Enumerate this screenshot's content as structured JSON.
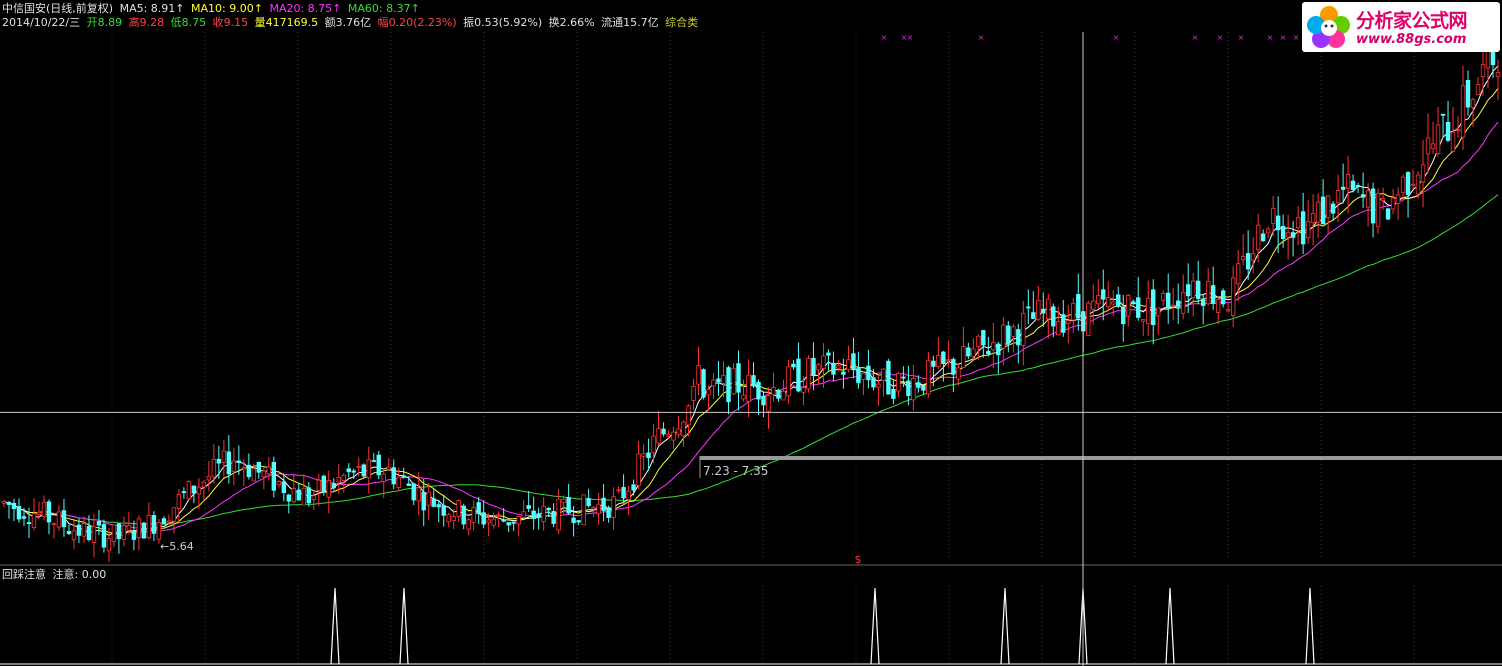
{
  "header": {
    "stock": "中信国安(日线,前复权)",
    "ma5": "MA5: 8.91↑",
    "ma10": "MA10: 9.00↑",
    "ma20": "MA20: 8.75↑",
    "ma60": "MA60: 8.37↑",
    "date": "2014/10/22/三",
    "open": "开8.89",
    "high": "高9.28",
    "low": "低8.75",
    "close": "收9.15",
    "volume": "量417169.5",
    "amount": "额3.76亿",
    "change": "幅0.20(2.23%)",
    "amplitude": "振0.53(5.92%)",
    "turnover": "换2.66%",
    "float": "流通15.7亿",
    "category": "综合类"
  },
  "logo": {
    "title": "分析家公式网",
    "url": "www.88gs.com"
  },
  "indicator": {
    "name": "回踩注意",
    "label": "注意: 0.00"
  },
  "annotations": {
    "low_label": "5.64",
    "range_label": "7.23 - 7.35",
    "signal_marker": "$"
  },
  "colors": {
    "background": "#000000",
    "up": "#ff3333",
    "down": "#55ffff",
    "ma5": "#ffffff",
    "ma10": "#ffff33",
    "ma20": "#ff33ff",
    "ma60": "#33dd33"
  },
  "chart_data": {
    "type": "candlestick",
    "price_range": [
      5.3,
      14.6
    ],
    "crosshair_price": 7.9,
    "candles_sample": [
      {
        "o": 6.2,
        "h": 6.35,
        "l": 6.05,
        "c": 6.1
      },
      {
        "o": 6.1,
        "h": 6.25,
        "l": 5.95,
        "c": 6.0
      },
      {
        "o": 5.95,
        "h": 6.05,
        "l": 5.75,
        "c": 5.8
      },
      {
        "o": 5.8,
        "h": 5.9,
        "l": 5.64,
        "c": 5.85
      },
      {
        "o": 6.0,
        "h": 6.5,
        "l": 5.95,
        "c": 6.45
      },
      {
        "o": 6.6,
        "h": 7.2,
        "l": 6.5,
        "c": 7.1
      },
      {
        "o": 7.0,
        "h": 7.25,
        "l": 6.6,
        "c": 6.7
      },
      {
        "o": 6.5,
        "h": 6.7,
        "l": 6.1,
        "c": 6.2
      },
      {
        "o": 6.6,
        "h": 7.0,
        "l": 6.5,
        "c": 6.9
      },
      {
        "o": 6.9,
        "h": 7.05,
        "l": 6.4,
        "c": 6.5
      },
      {
        "o": 6.1,
        "h": 6.2,
        "l": 5.9,
        "c": 5.95
      },
      {
        "o": 6.0,
        "h": 6.1,
        "l": 5.95,
        "c": 6.05
      },
      {
        "o": 6.3,
        "h": 6.45,
        "l": 6.25,
        "c": 6.4
      },
      {
        "o": 7.23,
        "h": 8.0,
        "l": 7.2,
        "c": 7.9
      },
      {
        "o": 8.1,
        "h": 8.5,
        "l": 8.0,
        "c": 8.4
      },
      {
        "o": 8.4,
        "h": 8.6,
        "l": 8.1,
        "c": 8.2
      },
      {
        "o": 8.5,
        "h": 9.0,
        "l": 8.4,
        "c": 8.9
      },
      {
        "o": 9.0,
        "h": 9.5,
        "l": 8.8,
        "c": 9.4
      },
      {
        "o": 9.4,
        "h": 9.6,
        "l": 9.0,
        "c": 9.1
      },
      {
        "o": 9.2,
        "h": 9.9,
        "l": 9.1,
        "c": 9.8
      },
      {
        "o": 10.5,
        "h": 11.4,
        "l": 10.3,
        "c": 11.2
      },
      {
        "o": 11.0,
        "h": 11.3,
        "l": 10.2,
        "c": 10.4
      },
      {
        "o": 10.8,
        "h": 11.8,
        "l": 10.7,
        "c": 11.6
      },
      {
        "o": 12.0,
        "h": 13.2,
        "l": 11.8,
        "c": 13.0
      },
      {
        "o": 13.0,
        "h": 14.5,
        "l": 12.8,
        "c": 14.3
      }
    ],
    "ma60_trend": [
      6.6,
      6.3,
      6.0,
      6.25,
      6.55,
      6.35,
      6.2,
      6.25,
      6.9,
      7.4,
      7.9,
      8.3,
      8.7,
      9.1,
      9.8,
      11.4
    ],
    "indicator_peaks_count": 7,
    "indicator_value": 0.0
  }
}
